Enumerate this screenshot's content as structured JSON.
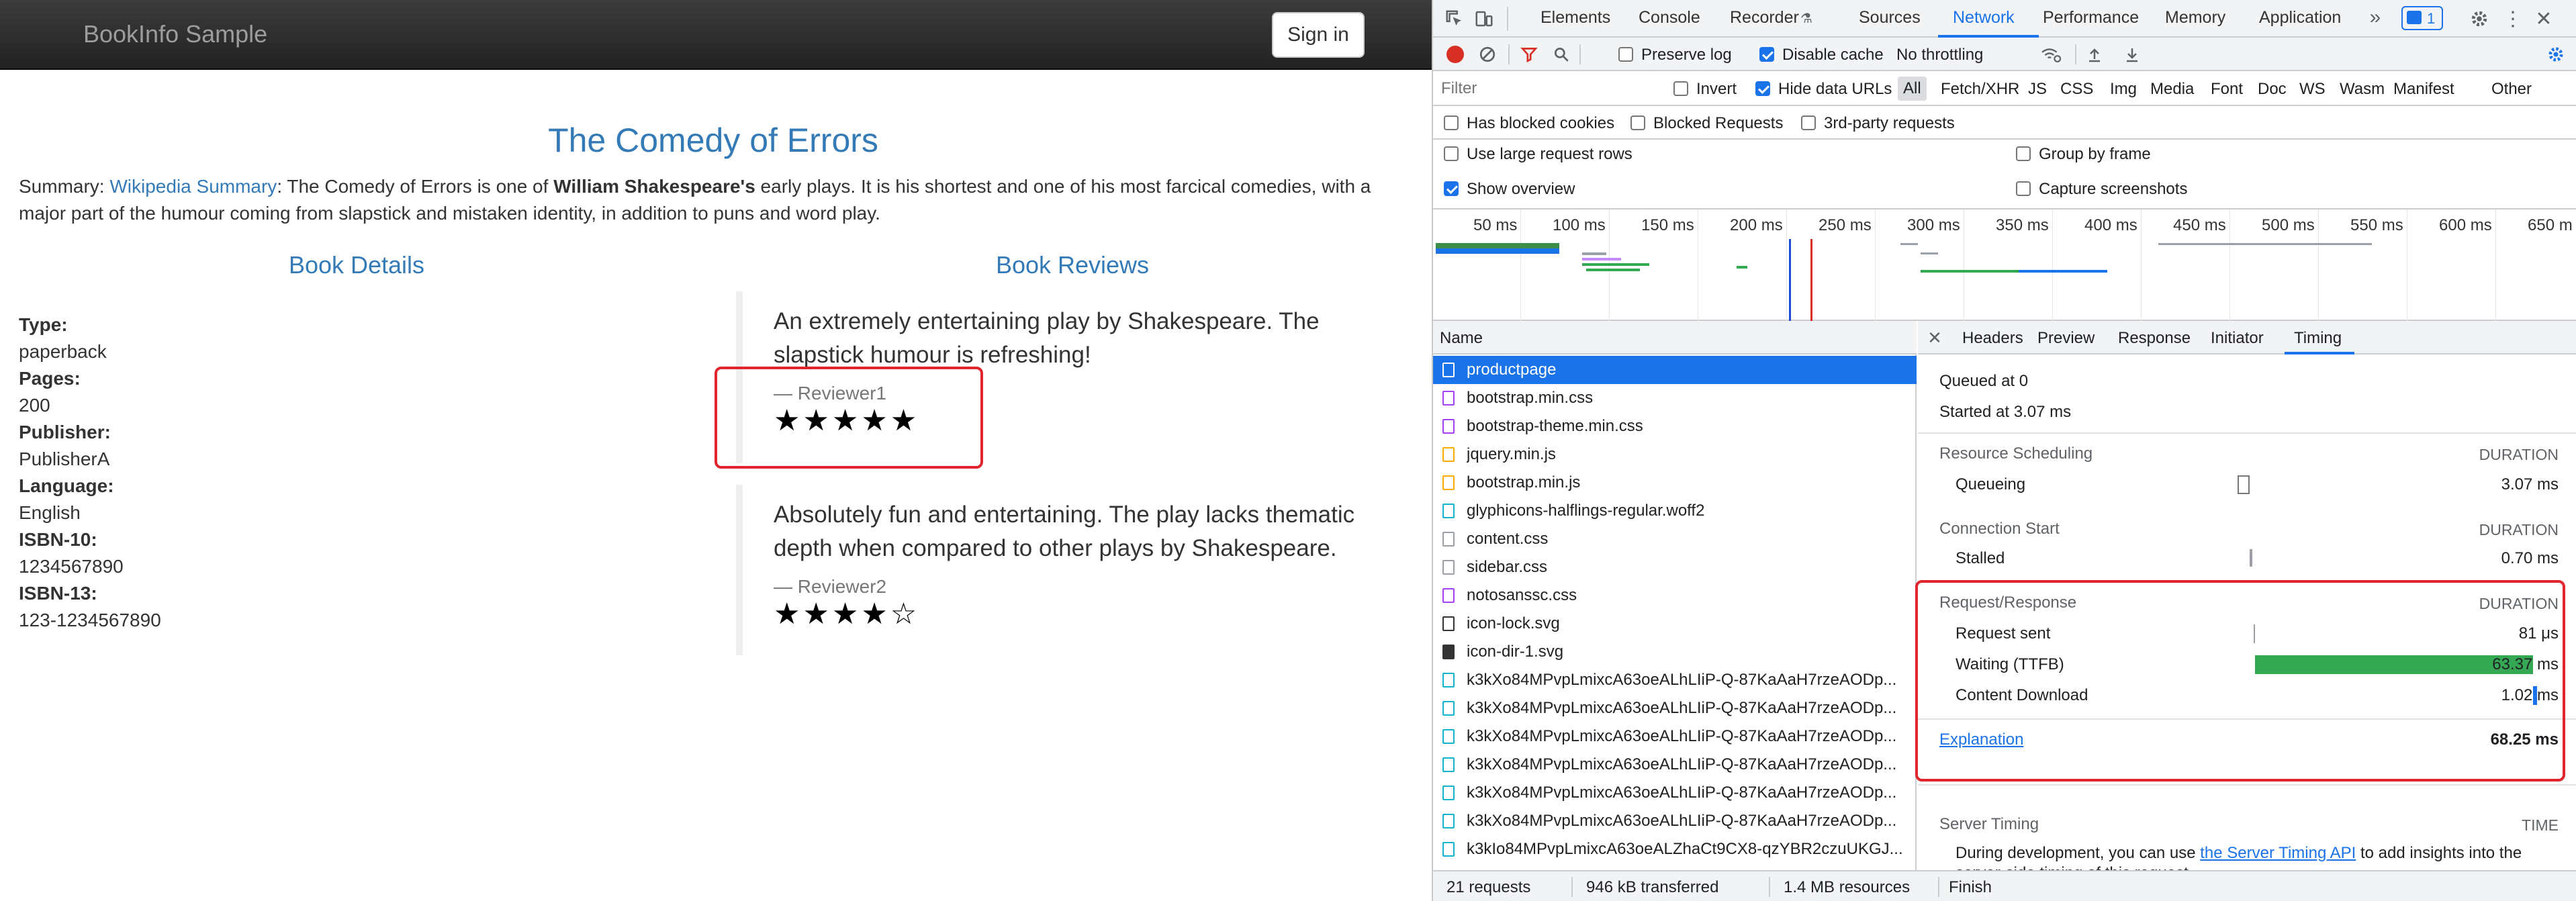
{
  "navbar": {
    "brand": "BookInfo Sample",
    "signin": "Sign in"
  },
  "book": {
    "title": "The Comedy of Errors",
    "summary_prefix": "Summary: ",
    "summary_link": "Wikipedia Summary",
    "summary_mid": ": The Comedy of Errors is one of ",
    "summary_bold": "William Shakespeare's",
    "summary_rest": " early plays. It is his shortest and one of his most farcical comedies, with a major part of the humour coming from slapstick and mistaken identity, in addition to puns and word play."
  },
  "details": {
    "heading": "Book Details",
    "items": [
      {
        "label": "Type:",
        "value": "paperback"
      },
      {
        "label": "Pages:",
        "value": "200"
      },
      {
        "label": "Publisher:",
        "value": "PublisherA"
      },
      {
        "label": "Language:",
        "value": "English"
      },
      {
        "label": "ISBN-10:",
        "value": "1234567890"
      },
      {
        "label": "ISBN-13:",
        "value": "123-1234567890"
      }
    ]
  },
  "reviews": {
    "heading": "Book Reviews",
    "items": [
      {
        "text": "An extremely entertaining play by Shakespeare. The slapstick humour is refreshing!",
        "reviewer": "— Reviewer1",
        "rating": 5,
        "stars": "★★★★★"
      },
      {
        "text": "Absolutely fun and entertaining. The play lacks thematic depth when compared to other plays by Shakespeare.",
        "reviewer": "— Reviewer2",
        "rating": 4,
        "stars": "★★★★☆"
      }
    ]
  },
  "devtools": {
    "tabs": [
      "Elements",
      "Console",
      "Recorder",
      "Sources",
      "Network",
      "Performance",
      "Memory",
      "Application"
    ],
    "active_tab": "Network",
    "issues_count": "1",
    "toolbar": {
      "preserve_log": "Preserve log",
      "disable_cache": "Disable cache",
      "throttling": "No throttling"
    },
    "filter": {
      "placeholder": "Filter",
      "invert": "Invert",
      "hide_data_urls": "Hide data URLs",
      "types": [
        "All",
        "Fetch/XHR",
        "JS",
        "CSS",
        "Img",
        "Media",
        "Font",
        "Doc",
        "WS",
        "Wasm",
        "Manifest",
        "Other"
      ],
      "has_blocked_cookies": "Has blocked cookies",
      "blocked_requests": "Blocked Requests",
      "third_party": "3rd-party requests"
    },
    "options": {
      "large_rows": "Use large request rows",
      "group_by_frame": "Group by frame",
      "show_overview": "Show overview",
      "capture_screenshots": "Capture screenshots"
    },
    "overview_ticks": [
      "50 ms",
      "100 ms",
      "150 ms",
      "200 ms",
      "250 ms",
      "300 ms",
      "350 ms",
      "400 ms",
      "450 ms",
      "500 ms",
      "550 ms",
      "600 ms",
      "650 m"
    ],
    "list_header": "Name",
    "requests": [
      {
        "name": "productpage",
        "type": "doc"
      },
      {
        "name": "bootstrap.min.css",
        "type": "css"
      },
      {
        "name": "bootstrap-theme.min.css",
        "type": "css"
      },
      {
        "name": "jquery.min.js",
        "type": "js"
      },
      {
        "name": "bootstrap.min.js",
        "type": "js"
      },
      {
        "name": "glyphicons-halflings-regular.woff2",
        "type": "font"
      },
      {
        "name": "content.css",
        "type": "other"
      },
      {
        "name": "sidebar.css",
        "type": "other"
      },
      {
        "name": "notosanssc.css",
        "type": "css"
      },
      {
        "name": "icon-lock.svg",
        "type": "img"
      },
      {
        "name": "icon-dir-1.svg",
        "type": "img"
      },
      {
        "name": "k3kXo84MPvpLmixcA63oeALhLIiP-Q-87KaAaH7rzeAODp...",
        "type": "font"
      },
      {
        "name": "k3kXo84MPvpLmixcA63oeALhLIiP-Q-87KaAaH7rzeAODp...",
        "type": "font"
      },
      {
        "name": "k3kXo84MPvpLmixcA63oeALhLIiP-Q-87KaAaH7rzeAODp...",
        "type": "font"
      },
      {
        "name": "k3kXo84MPvpLmixcA63oeALhLIiP-Q-87KaAaH7rzeAODp...",
        "type": "font"
      },
      {
        "name": "k3kXo84MPvpLmixcA63oeALhLIiP-Q-87KaAaH7rzeAODp...",
        "type": "font"
      },
      {
        "name": "k3kXo84MPvpLmixcA63oeALhLIiP-Q-87KaAaH7rzeAODp...",
        "type": "font"
      },
      {
        "name": "k3kIo84MPvpLmixcA63oeALZhaCt9CX8-qzYBR2czuUKGJ...",
        "type": "font"
      }
    ],
    "status": {
      "requests": "21 requests",
      "transferred": "946 kB transferred",
      "resources": "1.4 MB resources",
      "finish": "Finish"
    },
    "detail_tabs": [
      "Headers",
      "Preview",
      "Response",
      "Initiator",
      "Timing"
    ],
    "active_detail_tab": "Timing",
    "timing": {
      "queued": "Queued at 0",
      "started": "Started at 3.07 ms",
      "resource_scheduling": "Resource Scheduling",
      "duration_label": "DURATION",
      "queueing": {
        "label": "Queueing",
        "value": "3.07 ms"
      },
      "connection_start": "Connection Start",
      "stalled": {
        "label": "Stalled",
        "value": "0.70 ms"
      },
      "request_response": "Request/Response",
      "request_sent": {
        "label": "Request sent",
        "value": "81 μs"
      },
      "waiting": {
        "label": "Waiting (TTFB)",
        "value": "63.37 ms"
      },
      "content_download": {
        "label": "Content Download",
        "value": "1.02 ms"
      },
      "explanation": "Explanation",
      "total": "68.25 ms",
      "server_timing": "Server Timing",
      "time_label": "TIME",
      "server_note_1": "During development, you can use ",
      "server_note_link": "the Server Timing API",
      "server_note_2": " to add insights into the server-side timing of this request."
    },
    "colors": {
      "accent": "#1a73e8",
      "waiting_bar": "#34a853",
      "highlight": "#e0252f"
    }
  }
}
